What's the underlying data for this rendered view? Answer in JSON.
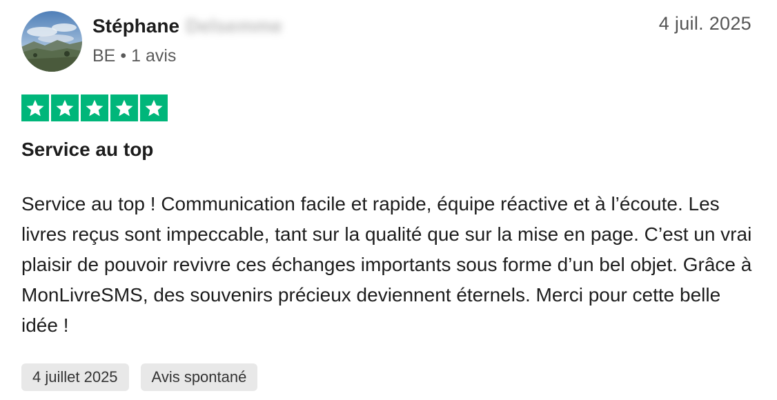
{
  "author": {
    "first_name": "Stéphane",
    "surname_blurred": "Delsemme",
    "country": "BE",
    "separator": "•",
    "review_count": "1 avis"
  },
  "review": {
    "date_header": "4 juil. 2025",
    "rating": 5,
    "max_rating": 5,
    "title": "Service au top",
    "body": "Service au top ! Communication facile et rapide, équipe réactive et à l’écoute. Les livres reçus sont impeccable, tant sur la qualité que sur la mise en page. C’est un vrai plaisir de pouvoir revivre ces échanges importants sous forme d’un bel objet. Grâce à MonLivreSMS, des souvenirs précieux deviennent éternels. Merci pour cette belle idée !"
  },
  "tags": {
    "experience_date": "4 juillet 2025",
    "review_type": "Avis spontané"
  },
  "icons": {
    "star": "star-icon",
    "avatar": "avatar-photo"
  },
  "colors": {
    "star_green": "#00b67a",
    "text": "#1c1c1c",
    "muted": "#555555",
    "tag_bg": "#e8e8e8"
  }
}
